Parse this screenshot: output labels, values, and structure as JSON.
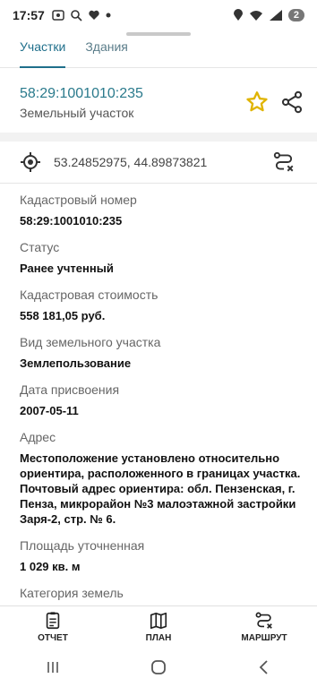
{
  "statusbar": {
    "time": "17:57",
    "badge": "2"
  },
  "tabs": [
    {
      "label": "Участки",
      "active": true
    },
    {
      "label": "Здания",
      "active": false
    }
  ],
  "header": {
    "cadastral_number": "58:29:1001010:235",
    "type": "Земельный участок"
  },
  "coordinates": "53.24852975, 44.89873821",
  "fields": [
    {
      "label": "Кадастровый номер",
      "value": "58:29:1001010:235"
    },
    {
      "label": "Статус",
      "value": "Ранее учтенный"
    },
    {
      "label": "Кадастровая стоимость",
      "value": "558 181,05 руб."
    },
    {
      "label": "Вид земельного участка",
      "value": "Землепользование"
    },
    {
      "label": "Дата присвоения",
      "value": "2007-05-11"
    },
    {
      "label": "Адрес",
      "value": "Местоположение установлено относительно ориентира, расположенного в границах участка. Почтовый адрес ориентира: обл. Пензенская, г. Пенза, микрорайон №3 малоэтажной застройки Заря-2, стр. № 6."
    },
    {
      "label": "Площадь уточненная",
      "value": "1 029 кв. м"
    },
    {
      "label": "Категория земель",
      "value": ""
    }
  ],
  "bottom_nav": [
    {
      "label": "ОТЧЕТ",
      "icon": "report-icon"
    },
    {
      "label": "ПЛАН",
      "icon": "map-icon"
    },
    {
      "label": "МАРШРУТ",
      "icon": "route-icon"
    }
  ],
  "colors": {
    "accent": "#1f6f8b",
    "star": "#e0b400"
  }
}
